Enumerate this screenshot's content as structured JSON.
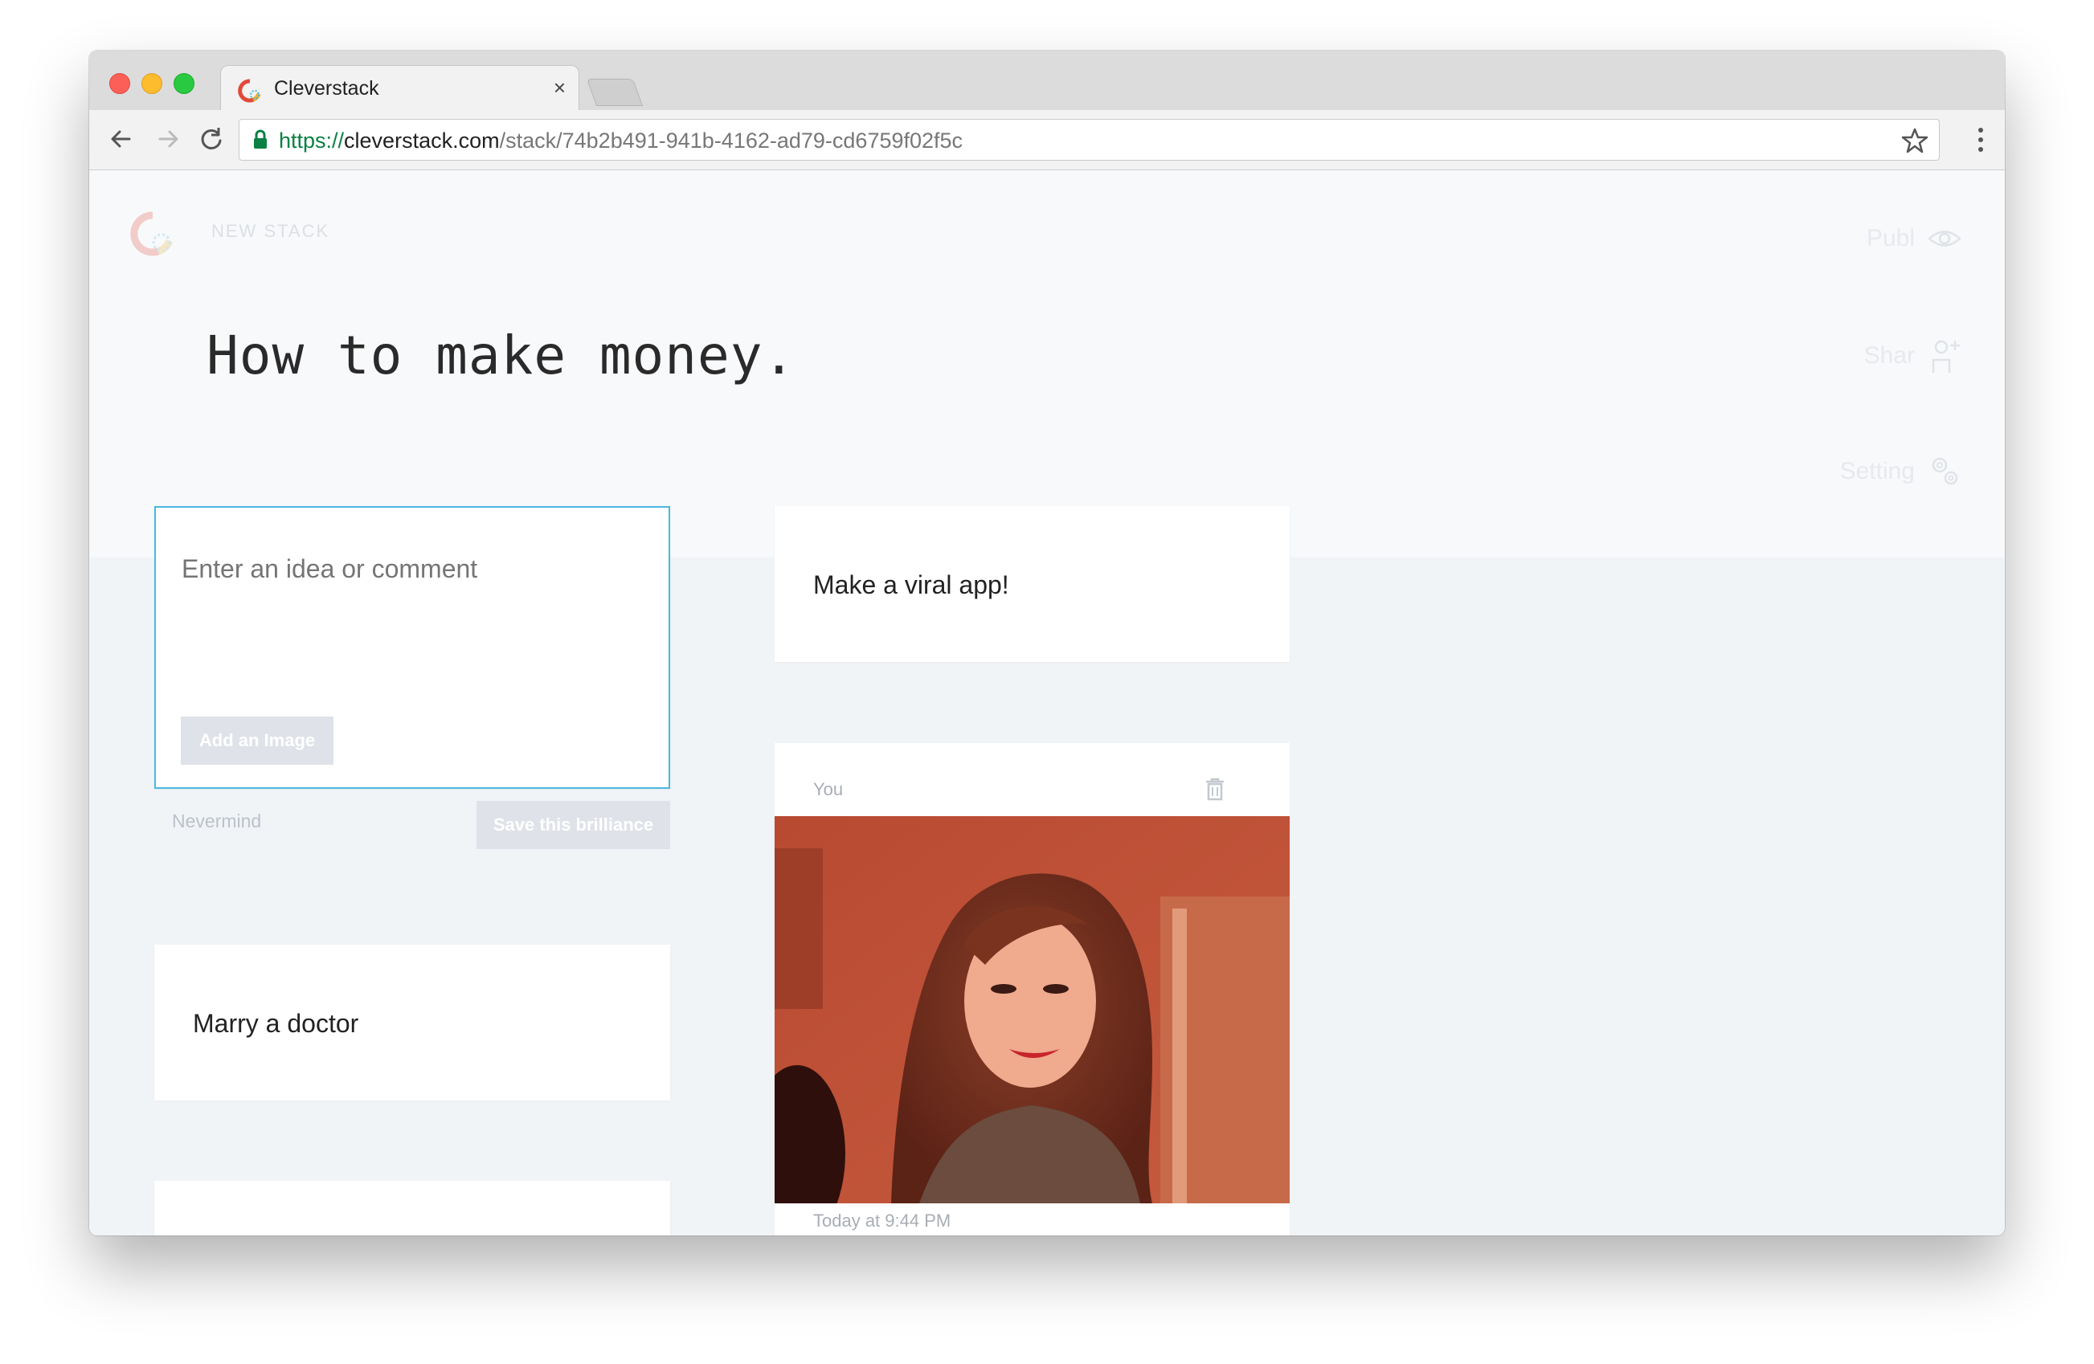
{
  "browser": {
    "tab_title": "Cleverstack",
    "tab_close": "×",
    "url_scheme": "https://",
    "url_host": "cleverstack.com",
    "url_path": "/stack/74b2b491-941b-4162-ad79-cd6759f02f5c",
    "icons": [
      "back-arrow-icon",
      "forward-arrow-icon",
      "reload-icon",
      "lock-icon",
      "star-icon",
      "menu-icon"
    ]
  },
  "header": {
    "section_label": "NEW STACK",
    "title": "How to make money."
  },
  "side_actions": [
    {
      "label": "Publ",
      "icon": "eye-icon"
    },
    {
      "label": "Shar",
      "icon": "add-person-icon"
    },
    {
      "label": "Setting",
      "icon": "settings-gears-icon"
    }
  ],
  "composer": {
    "placeholder": "Enter an idea or comment",
    "add_image_label": "Add an Image",
    "cancel_label": "Nevermind",
    "save_label": "Save this brilliance"
  },
  "cards": [
    {
      "text": "Make a viral app!"
    },
    {
      "text": "Marry a doctor"
    },
    {
      "author": "You",
      "timestamp": "Today at 9:44 PM",
      "has_image": true
    }
  ],
  "colors": {
    "accent": "#4ab8e0",
    "page_bg": "#f1f4f7",
    "header_bg": "#f8f9fb",
    "secure_green": "#0b8043"
  }
}
